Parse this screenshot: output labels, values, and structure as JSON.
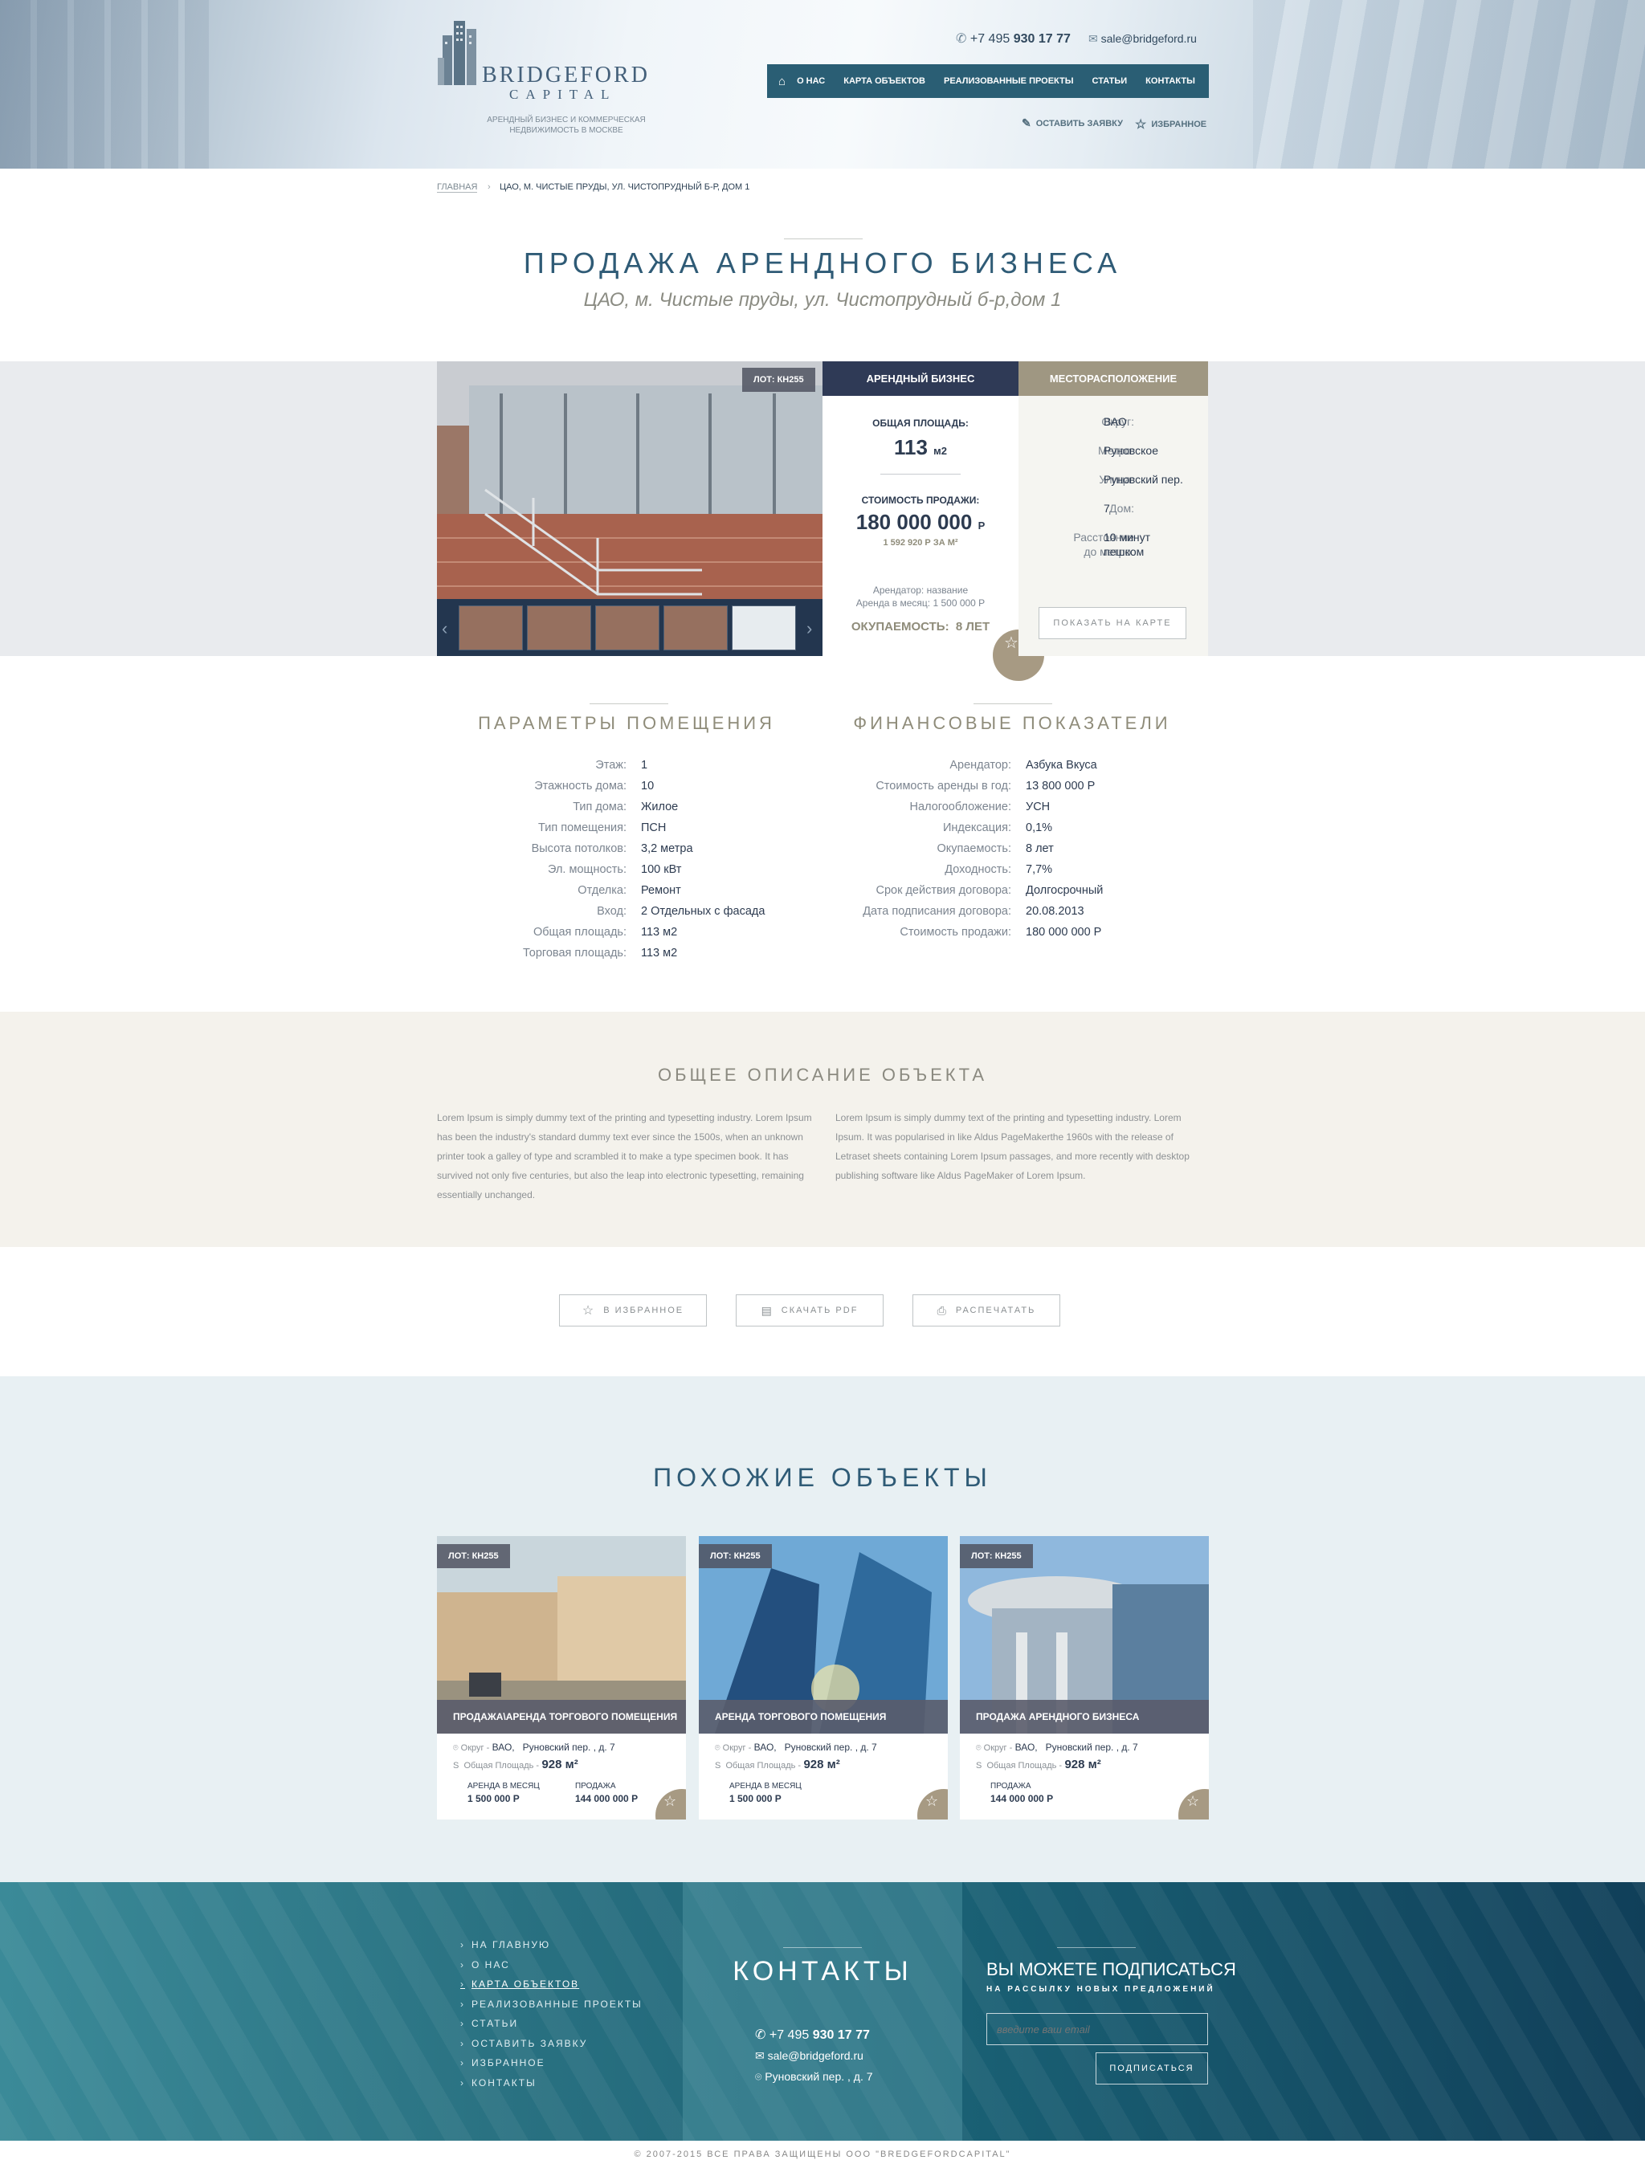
{
  "header": {
    "logo_title": "BRIDGEFORD",
    "logo_sub": "CAPITAL",
    "tagline": "Арендный бизнес и коммерческая недвижимость в Москве",
    "phone_prefix": "+7 495",
    "phone_main": "930 17 77",
    "email": "sale@bridgeford.ru",
    "nav": [
      "О нас",
      "Карта объектов",
      "Реализованные проекты",
      "Статьи",
      "Контакты"
    ],
    "request_label": "Оставить заявку",
    "favorites_label": "Избранное"
  },
  "breadcrumb": {
    "home": "Главная",
    "current": "ЦАО, м. Чистые пруды, ул. Чистопрудный б-р, дом 1"
  },
  "page": {
    "title": "Продажа арендного бизнеса",
    "subtitle": "ЦАО, м. Чистые пруды, ул. Чистопрудный б-р,дом 1"
  },
  "lot": {
    "badge": "Лот: КН255",
    "type_header": "Арендный бизнес",
    "area_label": "Общая площадь:",
    "area_value": "113",
    "area_unit": "м2",
    "price_label": "Стоимость продажи:",
    "price_value": "180 000 000",
    "price_currency": "р",
    "price_per_m": "1 592 920 Р за м²",
    "tenant_line": "Арендатор: название",
    "rent_line": "Аренда в месяц: 1 500 000 Р",
    "payback_label": "Окупаемость:",
    "payback_value": "8 лет",
    "location_header": "Месторасположение",
    "location": [
      {
        "k": "Округ:",
        "v": "ВАО"
      },
      {
        "k": "Метро:",
        "v": "Руновское"
      },
      {
        "k": "Улица:",
        "v": "Руновский пер."
      },
      {
        "k": "Дом:",
        "v": "7"
      }
    ],
    "distance_k1": "Расстояние",
    "distance_k2": "до метро:",
    "distance_v1": "10 минут",
    "distance_v2": "пешком",
    "map_button": "Показать на карте"
  },
  "params": {
    "title": "Параметры помещения",
    "rows": [
      {
        "k": "Этаж:",
        "v": "1"
      },
      {
        "k": "Этажность дома:",
        "v": "10"
      },
      {
        "k": "Тип дома:",
        "v": "Жилое"
      },
      {
        "k": "Тип помещения:",
        "v": "ПСН"
      },
      {
        "k": "Высота потолков:",
        "v": "3,2 метра"
      },
      {
        "k": "Эл. мощность:",
        "v": "100 кВт"
      },
      {
        "k": "Отделка:",
        "v": "Ремонт"
      },
      {
        "k": "Вход:",
        "v": "2 Отдельных с фасада"
      },
      {
        "k": "Общая площадь:",
        "v": "113 м2"
      },
      {
        "k": "Торговая площадь:",
        "v": "113 м2"
      }
    ]
  },
  "finance": {
    "title": "Финансовые показатели",
    "rows": [
      {
        "k": "Арендатор:",
        "v": "Азбука Вкуса"
      },
      {
        "k": "Стоимость аренды в год:",
        "v": "13 800 000 Р"
      },
      {
        "k": "Налогообложение:",
        "v": "УСН"
      },
      {
        "k": "Индексация:",
        "v": "0,1%"
      },
      {
        "k": "Окупаемость:",
        "v": "8 лет"
      },
      {
        "k": "Доходность:",
        "v": "7,7%"
      },
      {
        "k": "Срок действия договора:",
        "v": "Долгосрочный"
      },
      {
        "k": "Дата подписания договора:",
        "v": "20.08.2013"
      },
      {
        "k": "Стоимость продажи:",
        "v": "180 000 000 Р"
      }
    ]
  },
  "description": {
    "title": "Общее описание объекта",
    "left": "Lorem Ipsum is simply dummy text of the printing and typesetting industry. Lorem Ipsum has been the industry's standard dummy text ever since the 1500s, when an unknown printer took a galley of type and scrambled it to make a type specimen book. It has survived not only five centuries, but also the leap into electronic typesetting, remaining essentially unchanged.",
    "right": "Lorem Ipsum is simply dummy text of the printing and typesetting industry. Lorem Ipsum. It was popularised in like Aldus PageMakerthe 1960s with the release of Letraset sheets containing Lorem Ipsum passages, and more recently with desktop publishing software like Aldus PageMaker of Lorem Ipsum."
  },
  "actions": {
    "fav": "В избранное",
    "pdf": "Скачать PDF",
    "print": "Распечатать"
  },
  "similar": {
    "title": "Похожие объекты",
    "cards": [
      {
        "badge": "Лот: КН255",
        "caption": "Продажа\\аренда торгового помещения",
        "district_label": "Округ -",
        "district": "ВАО,",
        "street": "Руновский пер. , д. 7",
        "area_label": "Общая Площадь -",
        "area": "928 м²",
        "rent_label": "Аренда в месяц",
        "rent": "1 500 000 Р",
        "sale_label": "Продажа",
        "sale": "144 000 000 Р"
      },
      {
        "badge": "Лот: КН255",
        "caption": "Аренда торгового помещения",
        "district_label": "Округ -",
        "district": "ВАО,",
        "street": "Руновский пер. , д. 7",
        "area_label": "Общая Площадь -",
        "area": "928 м²",
        "rent_label": "Аренда в месяц",
        "rent": "1 500 000 Р"
      },
      {
        "badge": "Лот: КН255",
        "caption": "Продажа  арендного бизнеса",
        "district_label": "Округ -",
        "district": "ВАО,",
        "street": "Руновский пер. , д. 7",
        "area_label": "Общая Площадь -",
        "area": "928 м²",
        "sale_label": "Продажа",
        "sale": "144 000 000 Р"
      }
    ]
  },
  "footer": {
    "nav": [
      "На главную",
      "О нас",
      "Карта объектов",
      "Реализованные проекты",
      "Статьи",
      "Оставить заявку",
      "Избранное",
      "Контакты"
    ],
    "contacts_title": "Контакты",
    "phone_prefix": "+7 495",
    "phone_main": "930 17 77",
    "email": "sale@bridgeford.ru",
    "address": "Руновский пер. , д. 7",
    "subscribe_title": "Вы можете подписаться",
    "subscribe_sub": "на рассылку новых предложений",
    "email_placeholder": "введите ваш email",
    "subscribe_button": "Подписаться",
    "copyright": "©  2007-2015  все права защищены ООО \"BREDGEFORDCAPITAL\""
  },
  "colors": {
    "nav_bg": "#2a5e74",
    "lot_type_bg": "#2f3a56",
    "location_bg": "#9f9782",
    "accent_gold": "#a79a83"
  }
}
